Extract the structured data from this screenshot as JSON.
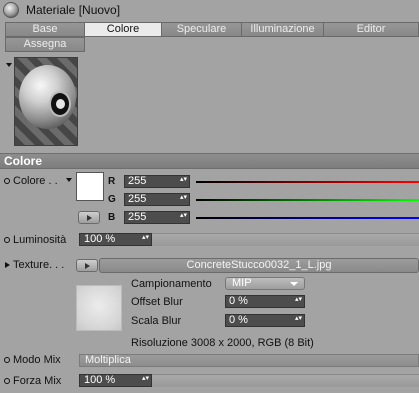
{
  "window": {
    "title": "Materiale [Nuovo]",
    "icon": "material-sphere-icon"
  },
  "tabs": [
    {
      "label": "Base",
      "active": false
    },
    {
      "label": "Colore",
      "active": true
    },
    {
      "label": "Speculare",
      "active": false
    },
    {
      "label": "Illuminazione",
      "active": false
    },
    {
      "label": "Editor",
      "active": false
    },
    {
      "label": "Assegna",
      "active": false
    }
  ],
  "section": {
    "title": "Colore"
  },
  "color": {
    "label": "Colore . .",
    "swatch_color": "#ffffff",
    "channels": [
      {
        "letter": "R",
        "value": "255",
        "gradient": "linear-gradient(90deg,#000,#ff0000)"
      },
      {
        "letter": "G",
        "value": "255",
        "gradient": "linear-gradient(90deg,#000,#00ff00)"
      },
      {
        "letter": "B",
        "value": "255",
        "gradient": "linear-gradient(90deg,#000,#0000ff)"
      }
    ]
  },
  "brightness": {
    "label": "Luminosità",
    "value": "100 %",
    "level_percent": 100
  },
  "texture": {
    "label": "Texture. . .",
    "filename": "ConcreteStucco0032_1_L.jpg",
    "sampling_label": "Campionamento",
    "sampling_value": "MIP",
    "offset_blur_label": "Offset Blur",
    "offset_blur_value": "0 %",
    "scale_blur_label": "Scala Blur",
    "scale_blur_value": "0 %",
    "resolution": "Risoluzione 3008 x 2000, RGB (8 Bit)"
  },
  "mix_mode": {
    "label": "Modo Mix",
    "value": "Moltiplica"
  },
  "mix_strength": {
    "label": "Forza Mix",
    "value": "100 %",
    "level_percent": 100
  },
  "spin_glyph": "▴▾"
}
